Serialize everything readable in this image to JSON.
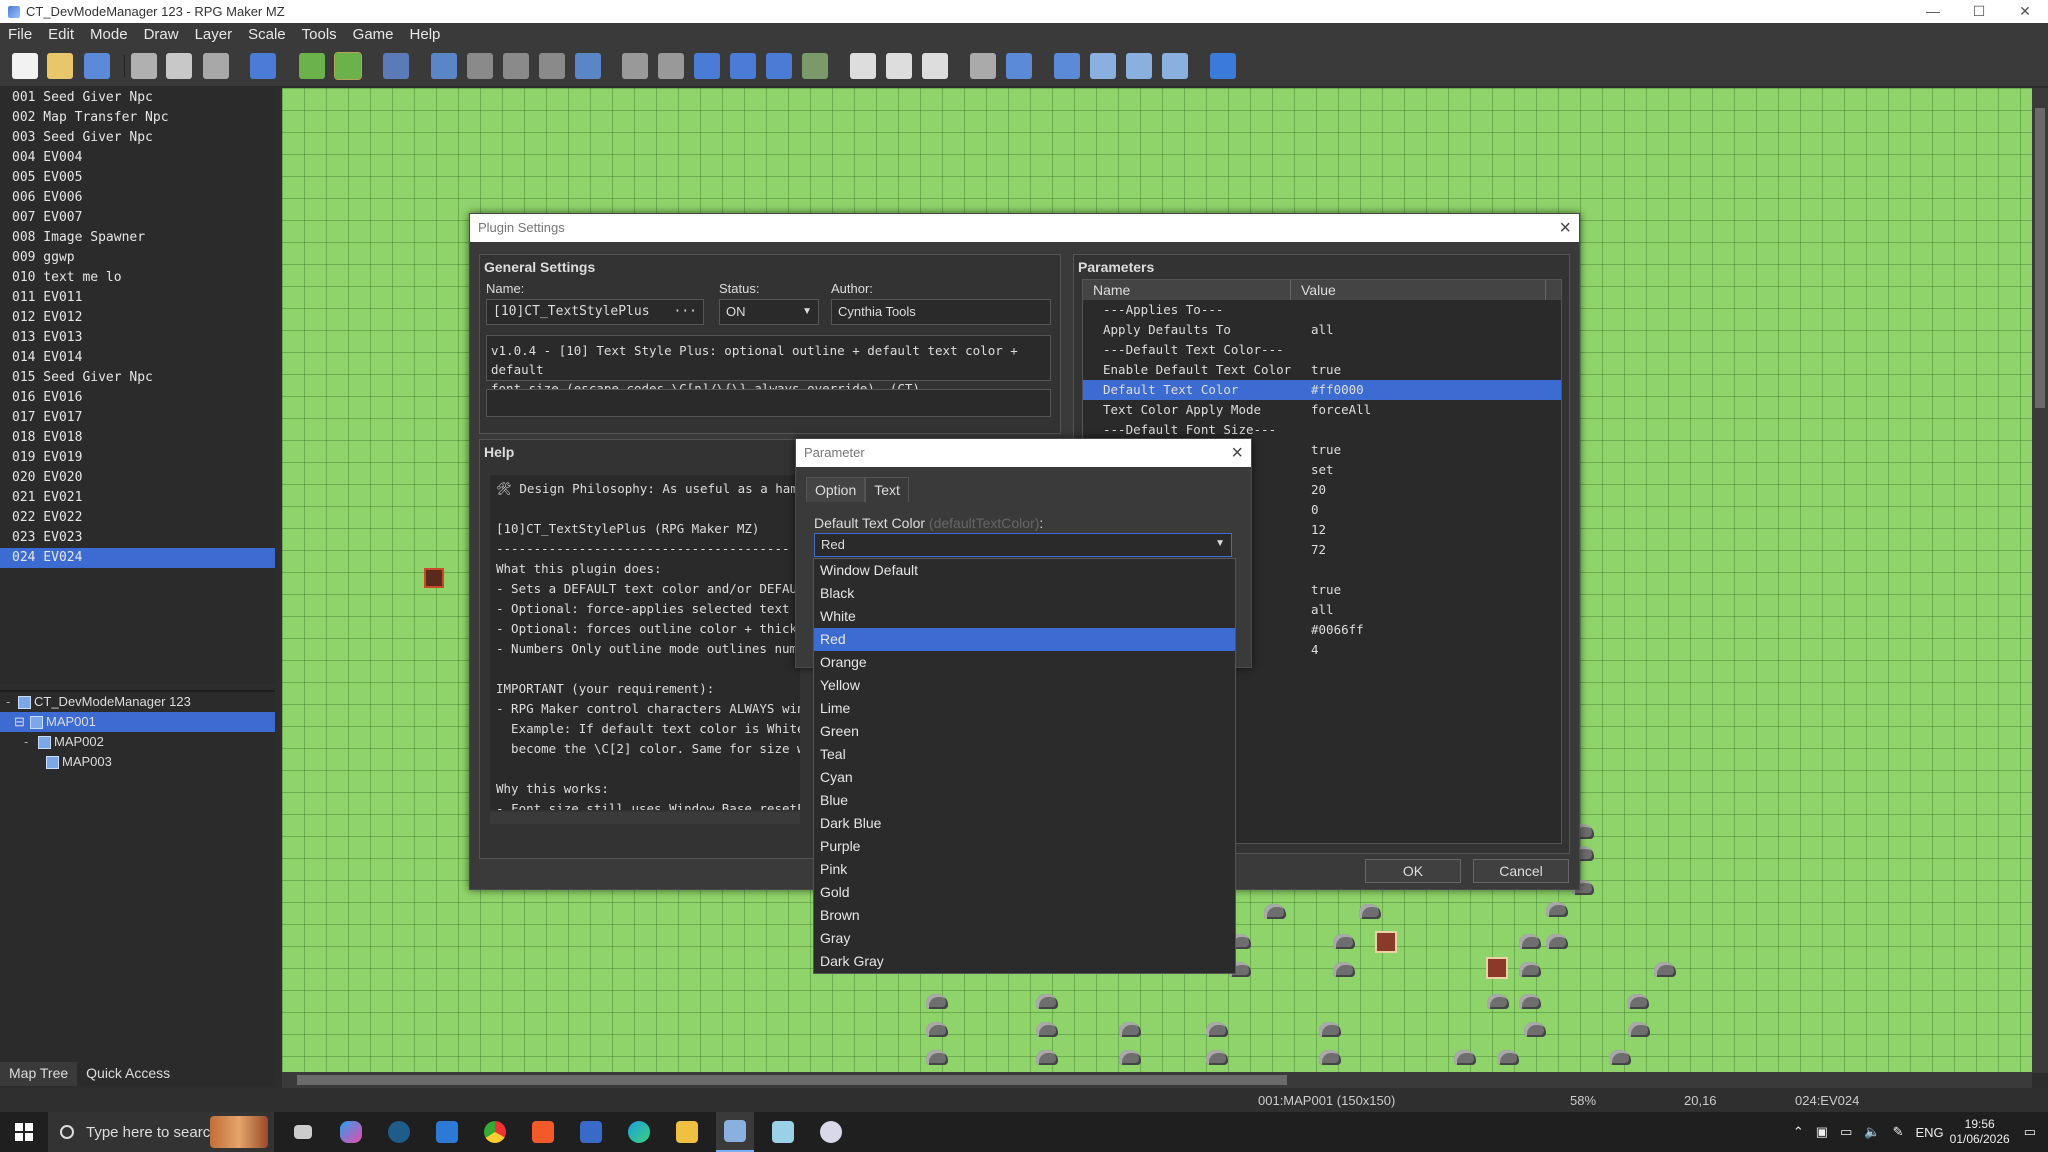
{
  "window": {
    "title": "CT_DevModeManager 123 - RPG Maker MZ",
    "minimize": "—",
    "maximize": "☐",
    "close": "✕"
  },
  "menu": [
    "File",
    "Edit",
    "Mode",
    "Draw",
    "Layer",
    "Scale",
    "Tools",
    "Game",
    "Help"
  ],
  "events": [
    "001 Seed Giver Npc",
    "002 Map Transfer Npc",
    "003 Seed Giver Npc",
    "004 EV004",
    "005 EV005",
    "006 EV006",
    "007 EV007",
    "008 Image Spawner",
    "009 ggwp",
    "010 text me lo",
    "011 EV011",
    "012 EV012",
    "013 EV013",
    "014 EV014",
    "015 Seed Giver Npc",
    "016 EV016",
    "017 EV017",
    "018 EV018",
    "019 EV019",
    "020 EV020",
    "021 EV021",
    "022 EV022",
    "023 EV023",
    "024 EV024"
  ],
  "selected_event_index": 23,
  "map_tree": {
    "project": "CT_DevModeManager 123",
    "maps": [
      "MAP001",
      "MAP002",
      "MAP003"
    ],
    "selected": "MAP001"
  },
  "bottom_tabs": [
    "Map Tree",
    "Quick Access"
  ],
  "status": {
    "map": "001:MAP001 (150x150)",
    "zoom": "58%",
    "coords": "20,16",
    "event": "024:EV024"
  },
  "plugin_dialog": {
    "title": "Plugin Settings",
    "general": "General Settings",
    "name_label": "Name:",
    "name_value": "[10]CT_TextStylePlus",
    "name_more": "···",
    "status_label": "Status:",
    "status_value": "ON",
    "author_label": "Author:",
    "author_value": "Cynthia Tools",
    "description_line1": "v1.0.4 - [10] Text Style Plus: optional outline + default text color + default",
    "description_line2": "font size (escape codes \\C[n]/\\{\\} always override). (CT)",
    "help_title": "Help",
    "help_text": "🛠 Design Philosophy: As useful as a hammer\n\n[10]CT_TextStylePlus (RPG Maker MZ)\n---------------------------------------\nWhat this plugin does:\n- Sets a DEFAULT text color and/or DEFAULT\n- Optional: force-applies selected text col\n- Optional: forces outline color + thicknes\n- Numbers Only outline mode outlines numeri\n\nIMPORTANT (your requirement):\n- RPG Maker control characters ALWAYS win.\n  Example: If default text color is White, but\n  become the \\C[2] color. Same for size with \\\n\nWhy this works:\n- Font size still uses Window_Base.resetFontSe\n- Default color still uses Window_Base.resetT",
    "params_title": "Parameters",
    "col_name": "Name",
    "col_value": "Value",
    "params": [
      {
        "name": "---Applies To---",
        "value": ""
      },
      {
        "name": "Apply Defaults To",
        "value": "all"
      },
      {
        "name": "---Default Text Color---",
        "value": ""
      },
      {
        "name": "Enable Default Text Color",
        "value": "true"
      },
      {
        "name": "Default Text Color",
        "value": "#ff0000"
      },
      {
        "name": "Text Color Apply Mode",
        "value": "forceAll"
      },
      {
        "name": "---Default Font Size---",
        "value": ""
      },
      {
        "name": "ze",
        "value": "true"
      },
      {
        "name": "",
        "value": "set"
      },
      {
        "name": "",
        "value": "20"
      },
      {
        "name": ")",
        "value": "0"
      },
      {
        "name": "",
        "value": "12"
      },
      {
        "name": "",
        "value": "72"
      },
      {
        "name": "",
        "value": ""
      },
      {
        "name": "de",
        "value": "true"
      },
      {
        "name": "",
        "value": "all"
      },
      {
        "name": "",
        "value": "#0066ff"
      },
      {
        "name": "",
        "value": "4"
      }
    ],
    "selected_param": 4,
    "ok": "OK",
    "cancel": "Cancel"
  },
  "param_dialog": {
    "title": "Parameter",
    "tabs": [
      "Option",
      "Text"
    ],
    "label": "Default Text Color",
    "hint": "(defaultTextColor)",
    "colon": ":",
    "selected": "Red",
    "options": [
      "Window Default",
      "Black",
      "White",
      "Red",
      "Orange",
      "Yellow",
      "Lime",
      "Green",
      "Teal",
      "Cyan",
      "Blue",
      "Dark Blue",
      "Purple",
      "Pink",
      "Gold",
      "Brown",
      "Gray",
      "Dark Gray"
    ],
    "selected_index": 3
  },
  "taskbar": {
    "search_placeholder": "Type here to search",
    "lang": "ENG",
    "time": "19:56",
    "date": "01/06/2026"
  },
  "colors": {
    "accent": "#3c6bd1",
    "grass": "#8fd46a",
    "panel": "#3a3a3a"
  }
}
